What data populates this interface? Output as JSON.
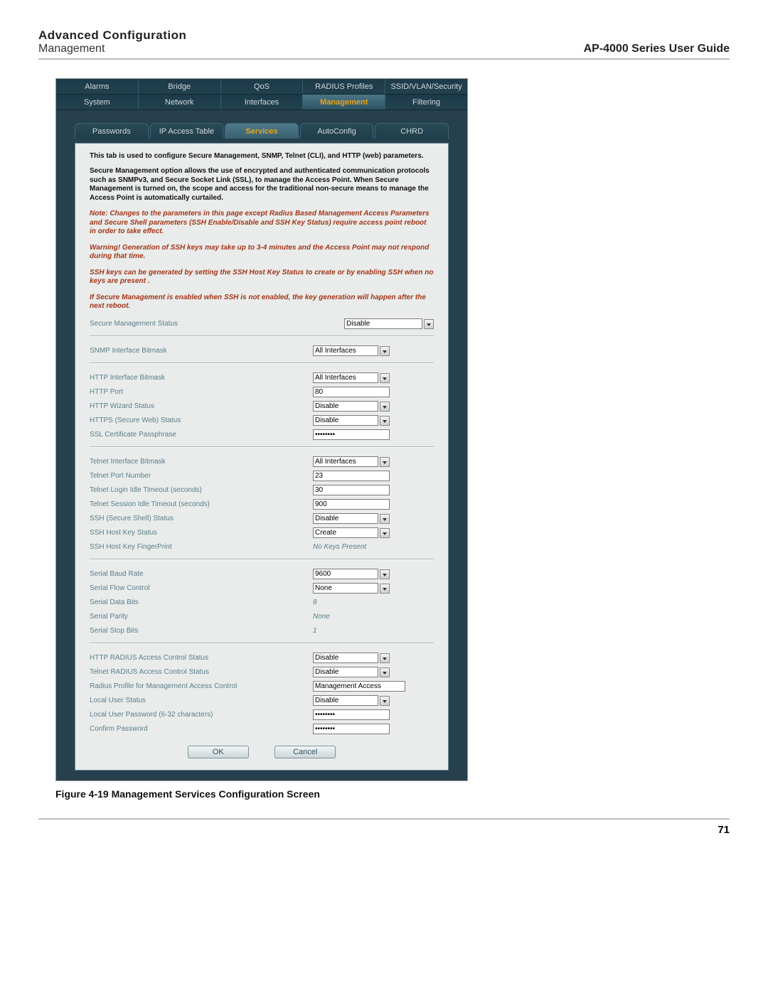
{
  "header": {
    "title": "Advanced Configuration",
    "subtitle": "Management",
    "guide": "AP-4000 Series User Guide"
  },
  "tabs_top": [
    "Alarms",
    "Bridge",
    "QoS",
    "RADIUS Profiles",
    "SSID/VLAN/Security"
  ],
  "tabs_mid": [
    "System",
    "Network",
    "Interfaces",
    "Management",
    "Filtering"
  ],
  "tabs_mid_active": "Management",
  "subtabs": [
    "Passwords",
    "IP Access Table",
    "Services",
    "AutoConfig",
    "CHRD"
  ],
  "subtabs_active": "Services",
  "intro": "This tab is used to configure Secure Management, SNMP, Telnet (CLI), and HTTP (web) parameters.",
  "para1": "Secure Management option allows the use of encrypted and authenticated communication protocols such as SNMPv3, and Secure Socket Link (SSL), to manage the Access Point. When Secure Management is turned on, the scope and access for the traditional non-secure means to manage the Access Point is automatically curtailed.",
  "warn1": "Note: Changes to the parameters in this page except Radius Based Management Access Parameters and Secure Shell parameters (SSH Enable/Disable and SSH Key Status) require access point reboot in order to take effect.",
  "warn2": "Warning! Generation of SSH keys may take up to 3-4 minutes and the Access Point may not respond during that time.",
  "warn3": "SSH keys can be generated by setting the SSH Host Key Status to create or by enabling SSH when no keys are present .",
  "warn4": "If Secure Management is enabled when SSH is not enabled, the key generation will happen after the next reboot.",
  "secure_mgmt": {
    "label": "Secure Management Status",
    "value": "Disable"
  },
  "snmp": {
    "bitmask_label": "SNMP Interface Bitmask",
    "bitmask_value": "All Interfaces"
  },
  "http": {
    "bitmask_label": "HTTP Interface Bitmask",
    "bitmask_value": "All Interfaces",
    "port_label": "HTTP Port",
    "port_value": "80",
    "wizard_label": "HTTP Wizard Status",
    "wizard_value": "Disable",
    "https_label": "HTTPS (Secure Web) Status",
    "https_value": "Disable",
    "sslpass_label": "SSL Certificate Passphrase",
    "sslpass_value": "********"
  },
  "telnet": {
    "bitmask_label": "Telnet Interface Bitmask",
    "bitmask_value": "All Interfaces",
    "port_label": "Telnet Port Number",
    "port_value": "23",
    "login_to_label": "Telnet Login Idle Timeout (seconds)",
    "login_to_value": "30",
    "sess_to_label": "Telnet Session Idle Timeout (seconds)",
    "sess_to_value": "900",
    "ssh_label": "SSH (Secure Shell) Status",
    "ssh_value": "Disable",
    "sshkey_label": "SSH Host Key Status",
    "sshkey_value": "Create",
    "sshfp_label": "SSH Host Key FingerPrint",
    "sshfp_value": "No Keys Present"
  },
  "serial": {
    "baud_label": "Serial Baud Rate",
    "baud_value": "9600",
    "flow_label": "Serial Flow Control",
    "flow_value": "None",
    "data_label": "Serial Data Bits",
    "data_value": "8",
    "parity_label": "Serial Parity",
    "parity_value": "None",
    "stop_label": "Serial Stop Bits",
    "stop_value": "1"
  },
  "radius": {
    "http_label": "HTTP RADIUS Access Control Status",
    "http_value": "Disable",
    "telnet_label": "Telnet RADIUS Access Control Status",
    "telnet_value": "Disable",
    "profile_label": "Radius Profile for Management Access Control",
    "profile_value": "Management Access",
    "local_label": "Local User Status",
    "local_value": "Disable",
    "pwd_label": "Local User Password (6-32 characters)",
    "pwd_value": "********",
    "confirm_label": "Confirm Password",
    "confirm_value": "********"
  },
  "buttons": {
    "ok": "OK",
    "cancel": "Cancel"
  },
  "caption": "Figure 4-19 Management Services Configuration Screen",
  "page_number": "71"
}
